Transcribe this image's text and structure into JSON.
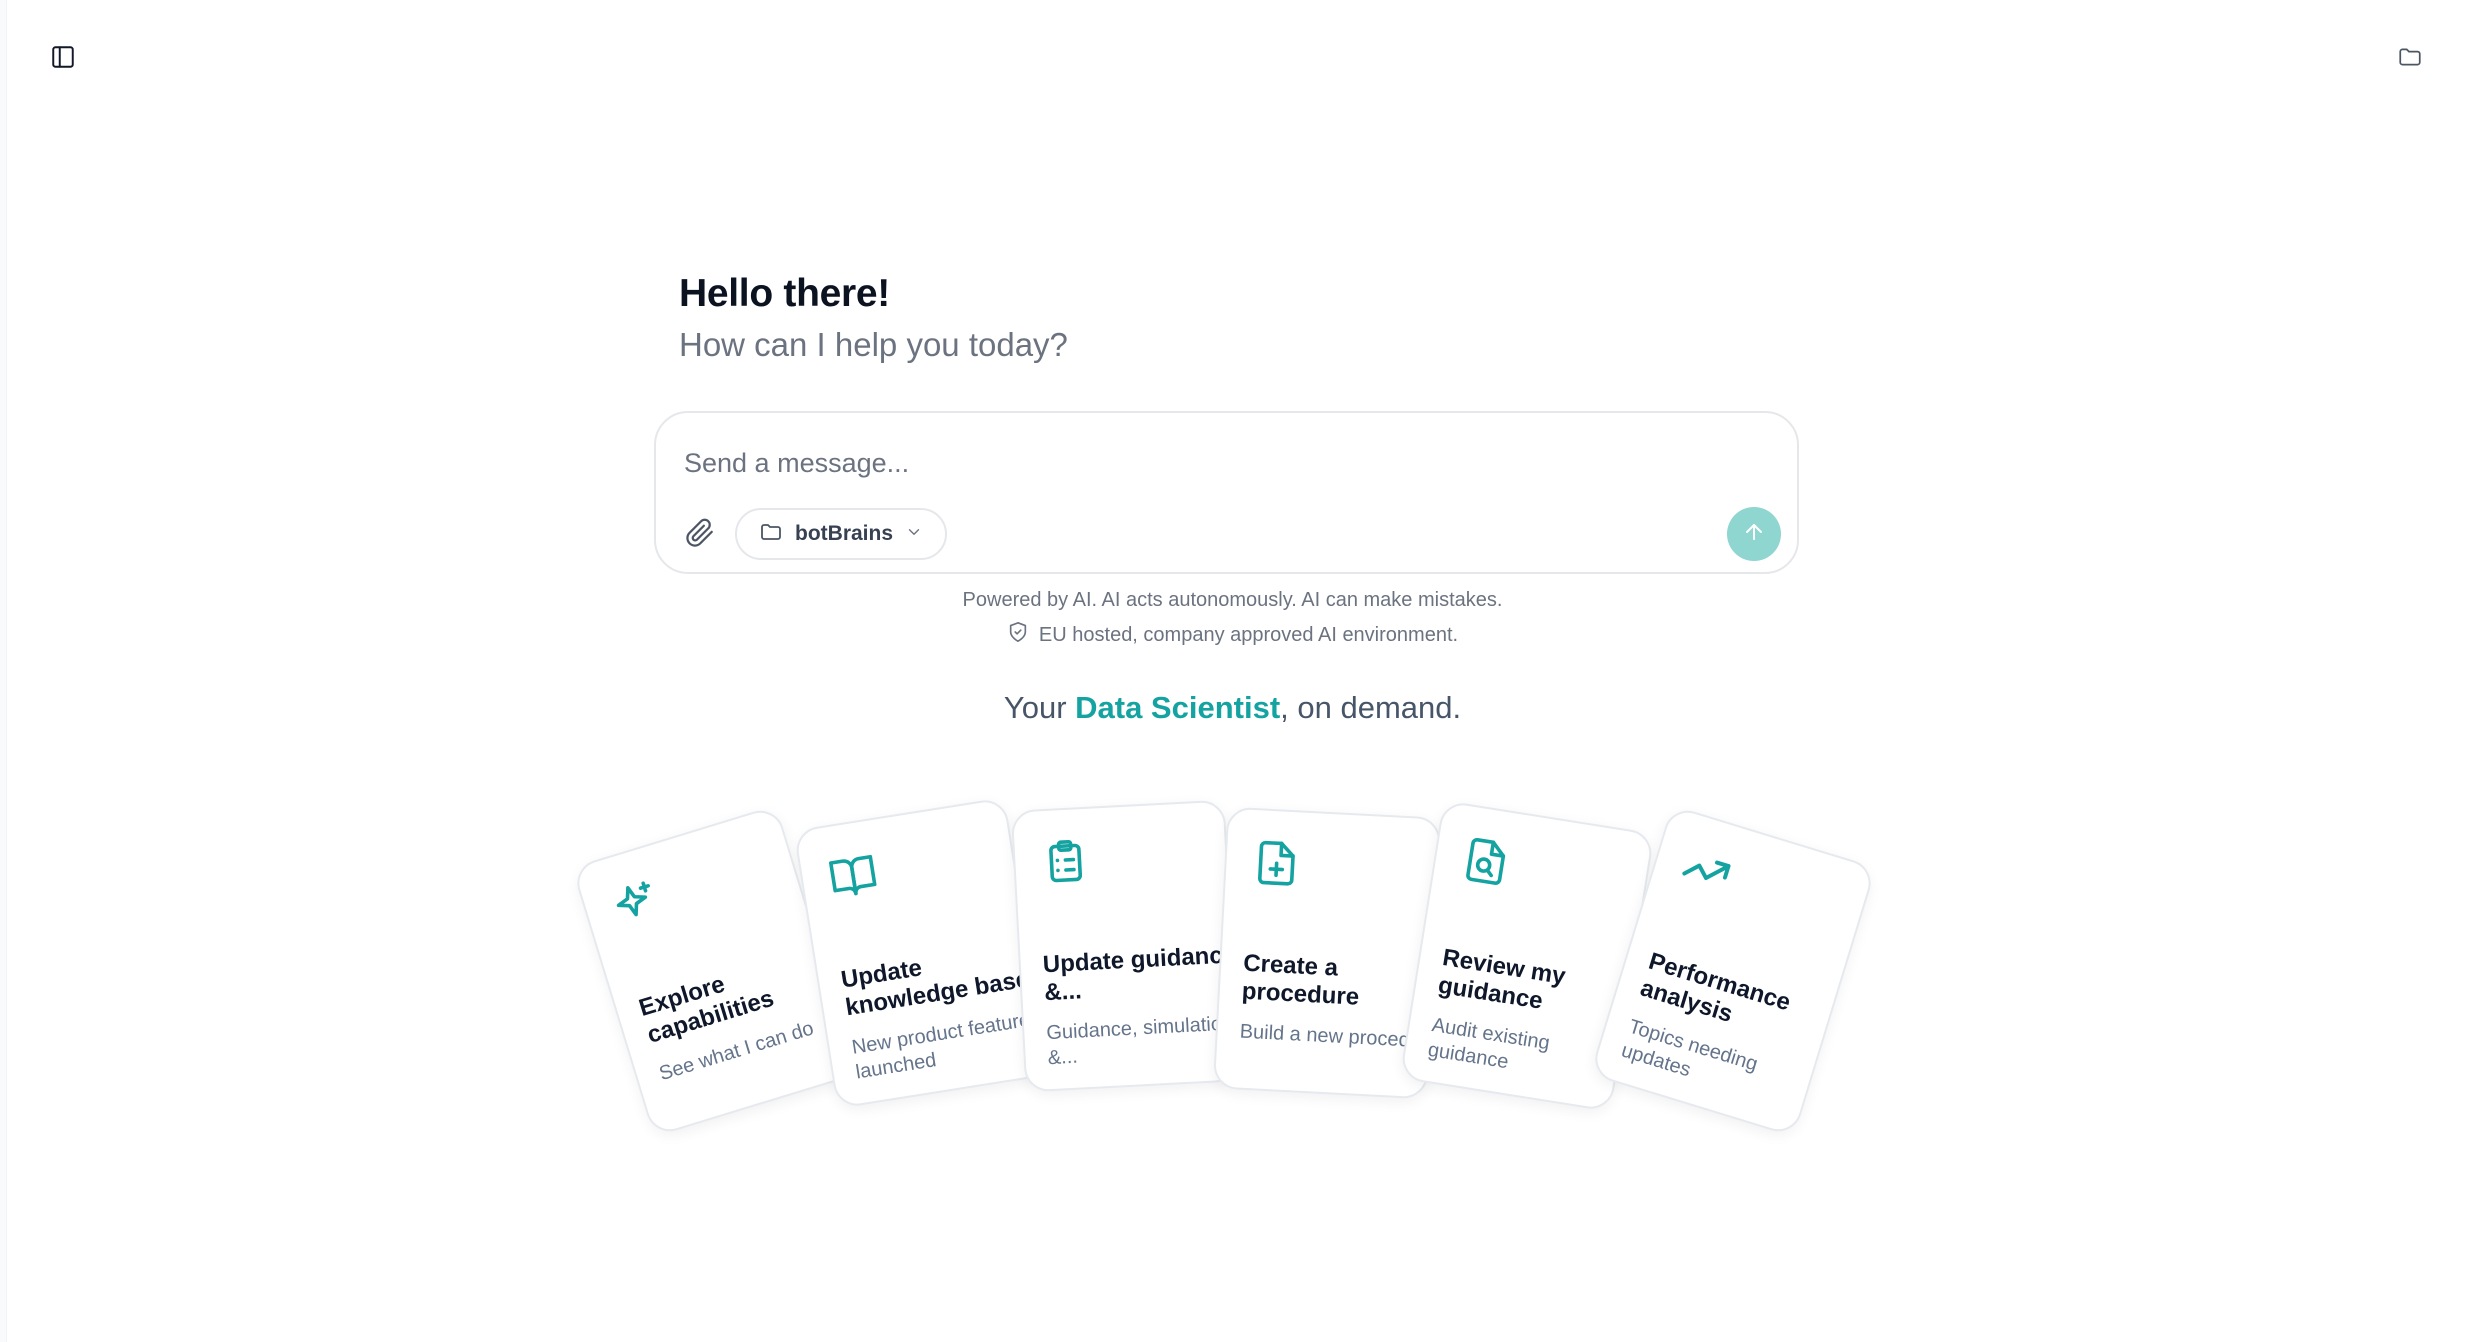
{
  "header": {
    "sidebar_toggle_icon": "sidebar-panel-icon",
    "folder_icon": "folder-icon"
  },
  "greeting": {
    "title": "Hello there!",
    "subtitle": "How can I help you today?"
  },
  "composer": {
    "placeholder": "Send a message...",
    "attach_icon": "paperclip-icon",
    "folder_select_label": "botBrains",
    "send_icon": "arrow-up-icon"
  },
  "disclaimer": {
    "line1": "Powered by AI. AI acts autonomously. AI can make mistakes.",
    "line2": "EU hosted, company approved AI environment."
  },
  "tagline": {
    "prefix": "Your ",
    "highlight": "Data Scientist",
    "suffix": ", on demand."
  },
  "colors": {
    "accent": "#14a3a0",
    "send_button": "#8fd6d1"
  },
  "cards": [
    {
      "icon": "sparkles-icon",
      "title": "Explore capabilities",
      "subtitle": "See what I can do"
    },
    {
      "icon": "book-open-icon",
      "title": "Update knowledge base",
      "subtitle": "New product feature launched"
    },
    {
      "icon": "clipboard-list-icon",
      "title": "Update guidance &...",
      "subtitle": "Guidance, simulations &..."
    },
    {
      "icon": "file-plus-icon",
      "title": "Create a procedure",
      "subtitle": "Build a new procedure"
    },
    {
      "icon": "file-search-icon",
      "title": "Review my guidance",
      "subtitle": "Audit existing guidance"
    },
    {
      "icon": "trending-up-icon",
      "title": "Performance analysis",
      "subtitle": "Topics needing updates"
    }
  ]
}
